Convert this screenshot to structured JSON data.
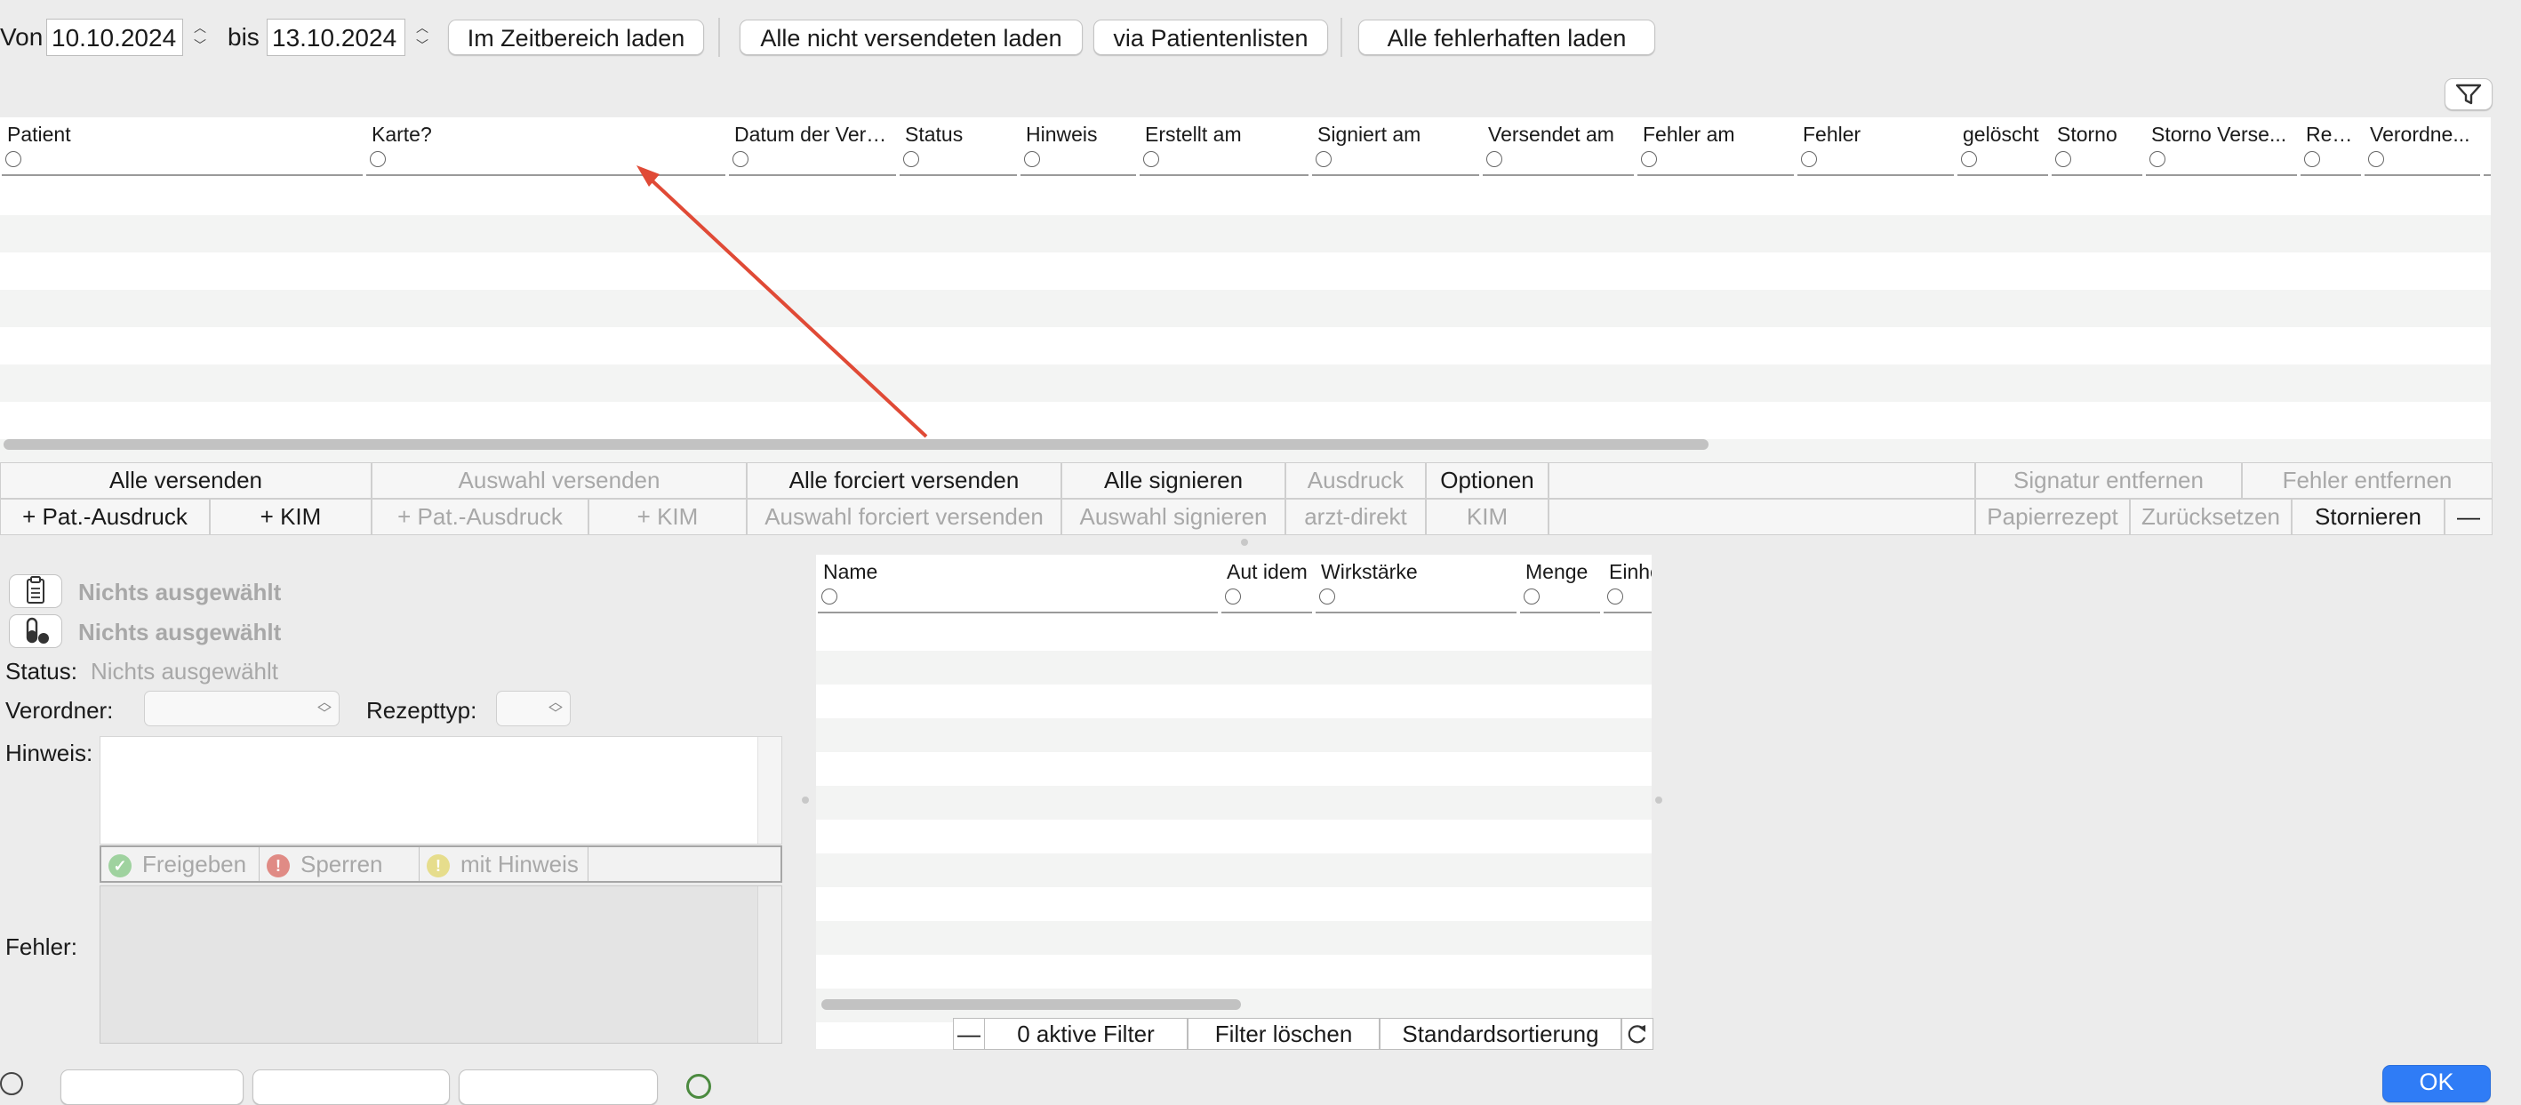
{
  "toolbar": {
    "from_label": "Von",
    "from_date": "10.10.2024",
    "to_label": "bis",
    "to_date": "13.10.2024",
    "load_range_button": "Im Zeitbereich laden",
    "load_unsent_button": "Alle nicht versendeten laden",
    "patient_lists_button": "via Patientenlisten",
    "load_errors_button": "Alle fehlerhaften laden"
  },
  "grid": {
    "columns": [
      "Patient",
      "Karte?",
      "Datum der Vero...",
      "Status",
      "Hinweis",
      "Erstellt am",
      "Signiert am",
      "Versendet am",
      "Fehler am",
      "Fehler",
      "gelöscht",
      "Storno",
      "Storno Verse...",
      "Rez...",
      "Verordne..."
    ],
    "rows": []
  },
  "actions_row1": {
    "send_all": "Alle versenden",
    "send_selection": "Auswahl versenden",
    "force_send_all": "Alle forciert versenden",
    "sign_all": "Alle signieren",
    "print": "Ausdruck",
    "options": "Optionen",
    "remove_signature": "Signatur entfernen",
    "remove_error": "Fehler entfernen"
  },
  "actions_row2": {
    "pat_print": "+ Pat.-Ausdruck",
    "kim": "+ KIM",
    "pat_print_sel": "+ Pat.-Ausdruck",
    "kim_sel": "+ KIM",
    "force_send_selection": "Auswahl forciert versenden",
    "sign_selection": "Auswahl signieren",
    "doctor_direct": "arzt-direkt",
    "kim_plain": "KIM",
    "paper_prescription": "Papierrezept",
    "reset": "Zurücksetzen",
    "cancel": "Stornieren",
    "minus": "—"
  },
  "details": {
    "nothing_selected_1": "Nichts ausgewählt",
    "nothing_selected_2": "Nichts ausgewählt",
    "status_label": "Status:",
    "status_value": "Nichts ausgewählt",
    "prescriber_label": "Verordner:",
    "rx_type_label": "Rezepttyp:",
    "note_label": "Hinweis:",
    "release": "Freigeben",
    "block": "Sperren",
    "with_note": "mit Hinweis",
    "error_label": "Fehler:"
  },
  "med_table": {
    "columns": [
      "Name",
      "Aut idem",
      "Wirkstärke",
      "Menge",
      "Einhe"
    ],
    "rows": []
  },
  "med_footer": {
    "minus": "—",
    "active_filters": "0 aktive Filter",
    "clear_filter": "Filter löschen",
    "default_sort": "Standardsortierung"
  },
  "ok_button": "OK",
  "colors": {
    "accent_blue": "#2f7cf6",
    "annotation_arrow": "#e04a36",
    "stripe": "#f3f4f3"
  }
}
